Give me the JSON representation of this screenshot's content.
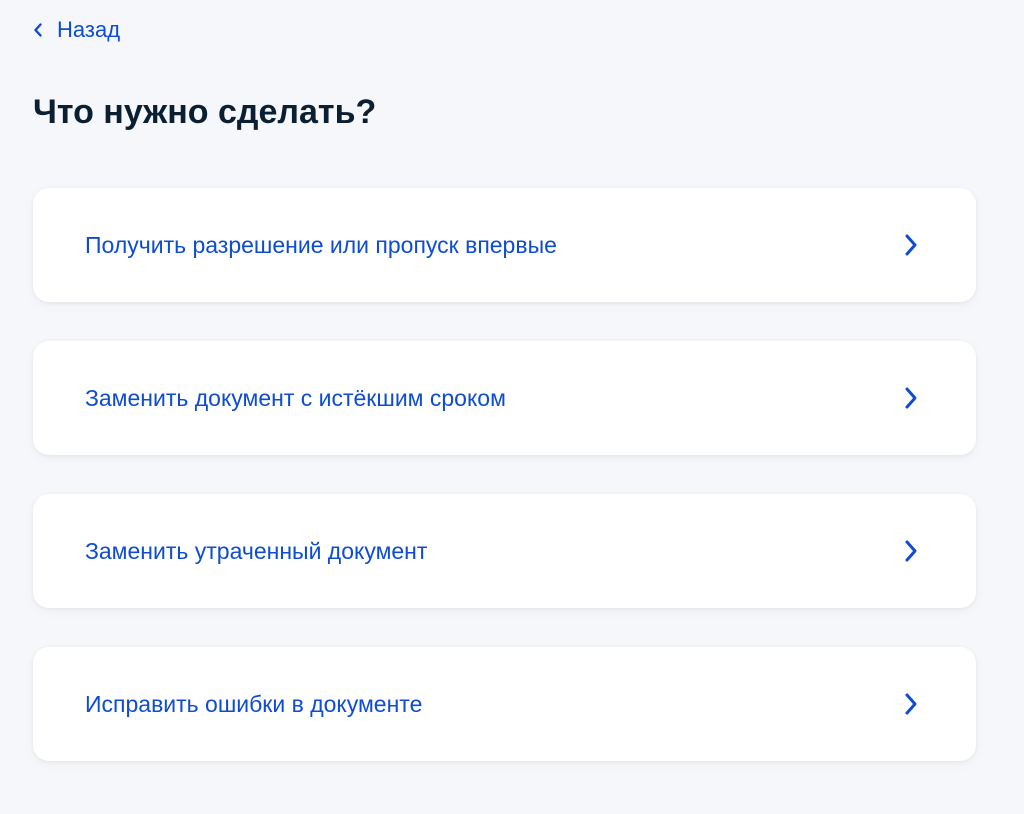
{
  "back": {
    "label": "Назад",
    "icon": "chevron-left-icon"
  },
  "page": {
    "title": "Что нужно сделать?"
  },
  "options": [
    {
      "label": "Получить разрешение или пропуск впервые",
      "icon": "chevron-right-icon"
    },
    {
      "label": "Заменить документ с истёкшим сроком",
      "icon": "chevron-right-icon"
    },
    {
      "label": "Заменить утраченный документ",
      "icon": "chevron-right-icon"
    },
    {
      "label": "Исправить ошибки в документе",
      "icon": "chevron-right-icon"
    }
  ],
  "colors": {
    "background": "#f5f7fb",
    "accent": "#0d4cd3",
    "title_text": "#0b1f33",
    "card": "#ffffff"
  }
}
